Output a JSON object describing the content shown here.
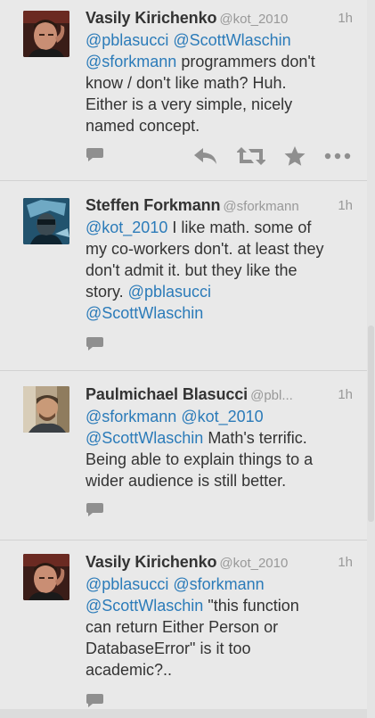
{
  "tweets": [
    {
      "name": "Vasily Kirichenko",
      "handle": "@kot_2010",
      "time": "1h",
      "avatar": "avatar-kot-2010",
      "lines": [
        [
          {
            "t": "@pblasucci",
            "m": true
          },
          {
            "t": " ",
            "m": false
          },
          {
            "t": "@ScottWlaschin",
            "m": true
          }
        ],
        [
          {
            "t": "@sforkmann",
            "m": true
          },
          {
            "t": " programmers don't",
            "m": false
          }
        ],
        [
          {
            "t": "know / don't like math? Huh.",
            "m": false
          }
        ],
        [
          {
            "t": "Either is a very simple, nicely",
            "m": false
          }
        ],
        [
          {
            "t": "named concept.",
            "m": false
          }
        ]
      ]
    },
    {
      "name": "Steffen Forkmann",
      "handle": "@sforkmann",
      "time": "1h",
      "avatar": "avatar-sforkmann",
      "lines": [
        [
          {
            "t": "@kot_2010",
            "m": true
          },
          {
            "t": " I like math. some of",
            "m": false
          }
        ],
        [
          {
            "t": "my co-workers don't. at least they",
            "m": false
          }
        ],
        [
          {
            "t": "don't admit it. but they like the",
            "m": false
          }
        ],
        [
          {
            "t": "story. ",
            "m": false
          },
          {
            "t": "@pblasucci",
            "m": true
          }
        ],
        [
          {
            "t": "@ScottWlaschin",
            "m": true
          }
        ]
      ]
    },
    {
      "name": "Paulmichael Blasucci",
      "handle": "@pbl...",
      "time": "1h",
      "avatar": "avatar-pblasucci",
      "lines": [
        [
          {
            "t": "@sforkmann",
            "m": true
          },
          {
            "t": " ",
            "m": false
          },
          {
            "t": "@kot_2010",
            "m": true
          }
        ],
        [
          {
            "t": "@ScottWlaschin",
            "m": true
          },
          {
            "t": " Math's terrific.",
            "m": false
          }
        ],
        [
          {
            "t": "Being able to explain things to a",
            "m": false
          }
        ],
        [
          {
            "t": "wider audience is still better.",
            "m": false
          }
        ]
      ]
    },
    {
      "name": "Vasily Kirichenko",
      "handle": "@kot_2010",
      "time": "1h",
      "avatar": "avatar-kot-2010",
      "lines": [
        [
          {
            "t": "@pblasucci",
            "m": true
          },
          {
            "t": " ",
            "m": false
          },
          {
            "t": "@sforkmann",
            "m": true
          }
        ],
        [
          {
            "t": "@ScottWlaschin",
            "m": true
          },
          {
            "t": " \"this function",
            "m": false
          }
        ],
        [
          {
            "t": "can return Either Person or",
            "m": false
          }
        ],
        [
          {
            "t": "DatabaseError\" is it too",
            "m": false
          }
        ],
        [
          {
            "t": "academic?..",
            "m": false
          }
        ]
      ]
    }
  ],
  "colors": {
    "background": "#e9e9e9",
    "text": "#333333",
    "muted": "#999999",
    "mention": "#2b7bb9",
    "icon": "#8f8f8f"
  },
  "icons": {
    "reply": "speech-bubble-icon",
    "retweet": "retweet-icon",
    "favorite": "star-icon",
    "more": "more-icon"
  }
}
